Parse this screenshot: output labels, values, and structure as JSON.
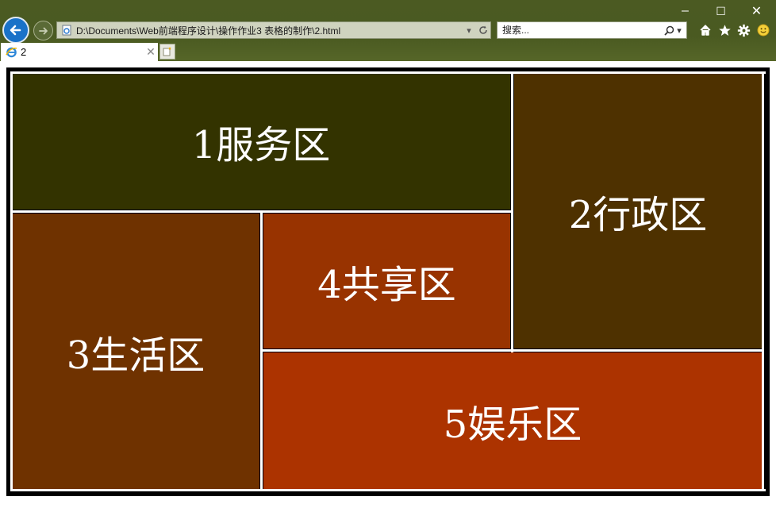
{
  "window": {
    "minimize_glyph": "–",
    "maximize_glyph": "☐",
    "close_glyph": "✕"
  },
  "address_bar": {
    "url": "D:\\Documents\\Web前端程序设计\\操作作业3 表格的制作\\2.html"
  },
  "search": {
    "placeholder": "搜索..."
  },
  "tabs": [
    {
      "title": "2"
    }
  ],
  "zones": {
    "service": {
      "label": "1服务区",
      "color": "#333300"
    },
    "admin": {
      "label": "2行政区",
      "color": "#4e3100"
    },
    "living": {
      "label": "3生活区",
      "color": "#6f3200"
    },
    "shared": {
      "label": "4共享区",
      "color": "#983300"
    },
    "entertainment": {
      "label": "5娱乐区",
      "color": "#ac3300"
    }
  },
  "colors": {
    "chrome": "#4a5a21",
    "border": "#ffffff",
    "table_frame": "#000000"
  }
}
